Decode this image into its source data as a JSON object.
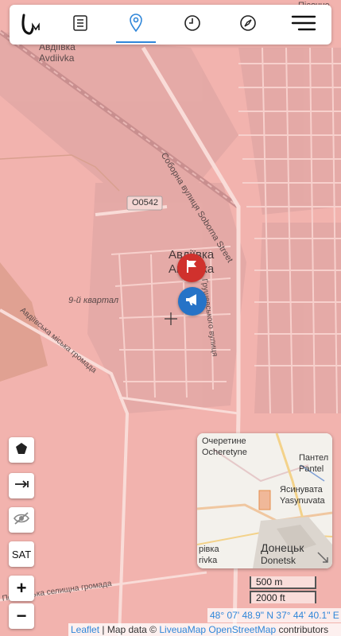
{
  "nav": {
    "logo": "LM",
    "tabs": [
      {
        "icon": "document-icon",
        "active": false
      },
      {
        "icon": "location-pin-icon",
        "active": true
      },
      {
        "icon": "clock-icon",
        "active": false
      },
      {
        "icon": "compass-icon",
        "active": false
      },
      {
        "icon": "menu-icon",
        "active": false
      }
    ],
    "accent": "#2f86d9"
  },
  "map": {
    "labels": {
      "avdiivka_uk": "Авдіївка",
      "avdiivka_en": "Avdiivka",
      "road_code": "O0542",
      "sobornaya": "Соборна вулиця Soborna Street",
      "town_uk": "Авдіївка",
      "town_en": "Авдіївка",
      "kvartal": "9-й квартал",
      "hrushevskoho": "Грушевського вулиця",
      "avd_st": "Авдіївська міська громада",
      "pokrovsk": "Покровська селищна громада",
      "pisochne": "Пісочне"
    },
    "colors": {
      "occupied_overlay": "#f2b3ae",
      "flag_marker": "#d0312d",
      "megaphone_marker": "#2673c7"
    },
    "markers": [
      {
        "icon": "flag-icon"
      },
      {
        "icon": "megaphone-icon"
      }
    ]
  },
  "controls": {
    "polygon": "pentagon-icon",
    "measure": "measure-icon",
    "hide": "eye-off-icon",
    "sat": "SAT",
    "zoom_in": "+",
    "zoom_out": "−"
  },
  "minimap": {
    "labels": {
      "ocheretyne_uk": "Очеретине",
      "ocheretyne_en": "Ocheretyne",
      "pantel_uk": "Пантел",
      "pantel_en": "Pantel",
      "yasynuvata_uk": "Ясинувата",
      "yasynuvata_en": "Yasynuvata",
      "rivka_uk": "рівка",
      "rivka_en": "rivka",
      "donetsk_uk": "Донецьк",
      "donetsk_en": "Donetsk"
    }
  },
  "scale": {
    "metric": "500 m",
    "imperial": "2000 ft"
  },
  "coords": "48° 07' 48.9\" N 37° 44' 40.1\" E",
  "attribution": {
    "leaflet": "Leaflet",
    "sep": " | Map data © ",
    "liveuamap": "LiveuaMap",
    "osm": "OpenStreetMap",
    "contributors": "contributors"
  }
}
